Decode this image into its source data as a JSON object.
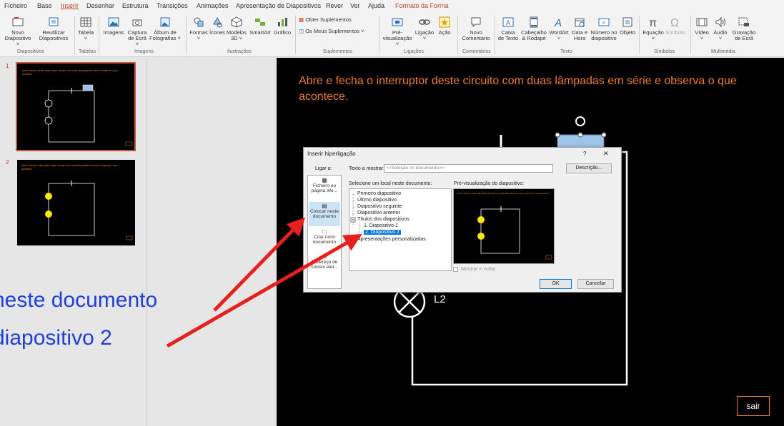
{
  "menu": {
    "tabs": [
      "Ficheiro",
      "Base",
      "Inserir",
      "Desenhar",
      "Estrutura",
      "Transições",
      "Animações",
      "Apresentação de Diapositivos",
      "Rever",
      "Ver",
      "Ajuda"
    ],
    "context_tab": "Formato da Forma",
    "active_tab": "Inserir"
  },
  "ribbon": {
    "novo": [
      "Novo",
      "Diapositivo ˅"
    ],
    "reutilizar": [
      "Reutilizar",
      "Diapositivos"
    ],
    "tabela": [
      "Tabela",
      "˅"
    ],
    "imagens": "Imagens",
    "captura": [
      "Captura",
      "de Ecrã ˅"
    ],
    "album": [
      "Álbum de",
      "Fotografias ˅"
    ],
    "formas": [
      "Formas",
      "˅"
    ],
    "icones": "Ícones",
    "modelos": [
      "Modelos",
      "3D ˅"
    ],
    "smartart": "SmartArt",
    "grafico": "Gráfico",
    "obter_suplementos": "Obter Suplementos",
    "meus_suplementos": "Os Meus Suplementos  ˅",
    "pre": [
      "Pré-",
      "visualização ˅"
    ],
    "ligacao": [
      "Ligação",
      "˅"
    ],
    "acao": "Ação",
    "novo_comentario": [
      "Novo",
      "Comentário"
    ],
    "caixa": [
      "Caixa",
      "de Texto"
    ],
    "cabecalho": [
      "Cabeçalho",
      "& Rodapé"
    ],
    "wordart": [
      "WordArt",
      "˅"
    ],
    "data_hora": [
      "Data e",
      "Hora"
    ],
    "numero": [
      "Número no",
      "diapositivo"
    ],
    "objeto": "Objeto",
    "equacao": [
      "Equação",
      "˅"
    ],
    "simbolo": "Símbolo",
    "video": [
      "Vídeo",
      "˅"
    ],
    "audio": [
      "Áudio",
      "˅"
    ],
    "gravacao": [
      "Gravação",
      "de Ecrã"
    ],
    "groups": {
      "diapositivos": "Diapositivos",
      "tabelas": "Tabelas",
      "imagens": "Imagens",
      "ilustracoes": "Ilustrações",
      "suplementos": "Suplementos",
      "ligacoes": "Ligações",
      "comentarios": "Comentários",
      "texto": "Texto",
      "simbolos": "Símbolos",
      "multimedia": "Multimédia"
    }
  },
  "thumbnails": [
    {
      "number": "1",
      "title": "Abre e fecha o interruptor deste circuito com duas lâmpadas em série e observa o que acontece."
    },
    {
      "number": "2",
      "title": "Abre e fecha o interruptor deste circuito com duas lâmpadas em série e observa o que acontece."
    }
  ],
  "slide": {
    "title": "Abre e fecha o interruptor deste circuito com duas lâmpadas em série e observa o que acontece.",
    "lamp_label": "L2",
    "exit_button": "sair"
  },
  "annotations": {
    "line1": "neste documento",
    "line2": "diapositivo 2",
    "arrow_color": "#e8201c"
  },
  "dialog": {
    "title": "Inserir hiperligação",
    "help": "?",
    "close": "✕",
    "link_to_label": "Ligar a:",
    "text_to_display_label": "Texto a mostrar:",
    "text_to_display_value": "<<Seleção no documento>>",
    "screentip_button": "Descrição...",
    "link_options": [
      [
        "Ficheiro ou",
        "página We..."
      ],
      [
        "Colocar neste",
        "documento"
      ],
      [
        "Criar novo",
        "documento"
      ],
      [
        "Endereço de",
        "correio elet..."
      ]
    ],
    "select_place_label": "Selecione um local neste documento:",
    "tree": {
      "first": "Primeiro diapositivo",
      "last": "Último diapositivo",
      "next": "Diapositivo seguinte",
      "prev": "Diapositivo anterior",
      "titles": "Títulos dos diapositivos",
      "slide1": "1. Diapositivo 1",
      "slide2": "2. Diapositivo 2",
      "custom": "Apresentações personalizadas"
    },
    "preview_label": "Pré-visualização do diapositivo:",
    "show_return": "Mostrar e voltar",
    "ok": "OK",
    "cancel": "Cancelar"
  },
  "colors": {
    "accent": "#b7472a",
    "slide_title": "#ed7d31",
    "lamp_on": "#ffe600",
    "annotation_text": "#1f3fd9"
  }
}
